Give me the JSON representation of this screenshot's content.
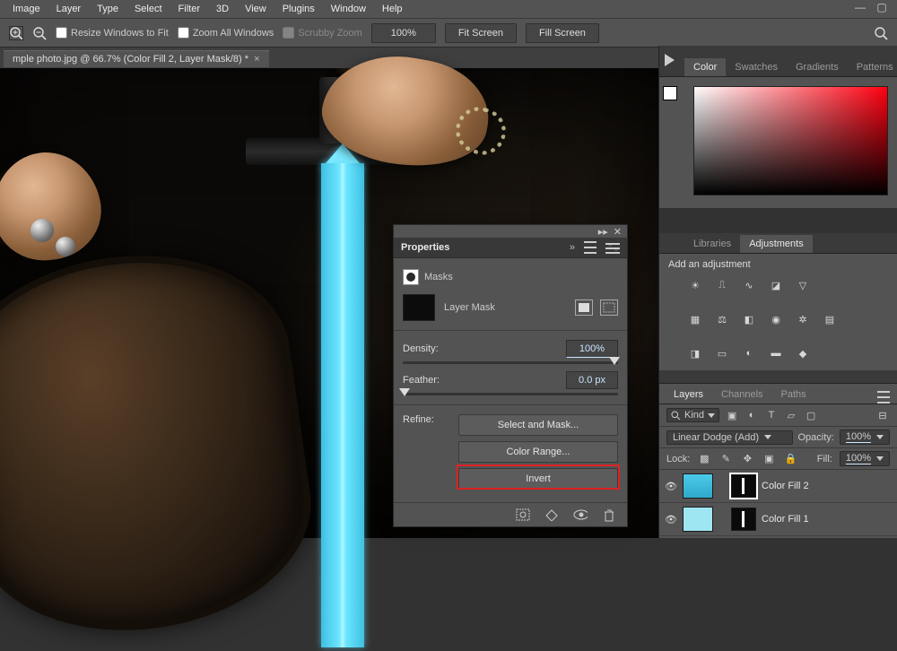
{
  "menubar": [
    "Image",
    "Layer",
    "Type",
    "Select",
    "Filter",
    "3D",
    "View",
    "Plugins",
    "Window",
    "Help"
  ],
  "optionsbar": {
    "resize_windows": "Resize Windows to Fit",
    "zoom_all": "Zoom All Windows",
    "scrubby": "Scrubby Zoom",
    "zoom_value": "100%",
    "fit_screen": "Fit Screen",
    "fill_screen": "Fill Screen"
  },
  "document_tab": {
    "title": "mple photo.jpg @ 66.7% (Color Fill 2, Layer Mask/8) *"
  },
  "properties": {
    "panel_title": "Properties",
    "section": "Masks",
    "mask_label": "Layer Mask",
    "density_label": "Density:",
    "density_value": "100%",
    "feather_label": "Feather:",
    "feather_value": "0.0 px",
    "refine_label": "Refine:",
    "select_and_mask": "Select and Mask...",
    "color_range": "Color Range...",
    "invert": "Invert"
  },
  "right": {
    "color_tabs": [
      "Color",
      "Swatches",
      "Gradients",
      "Patterns"
    ],
    "lib_tabs": [
      "Libraries",
      "Adjustments"
    ],
    "add_adjustment": "Add an adjustment",
    "layers_tabs": [
      "Layers",
      "Channels",
      "Paths"
    ],
    "kind_label": "Kind",
    "blend_mode": "Linear Dodge (Add)",
    "opacity_label": "Opacity:",
    "opacity_value": "100%",
    "lock_label": "Lock:",
    "fill_label": "Fill:",
    "fill_value": "100%",
    "layers": [
      {
        "name": "Color Fill 2"
      },
      {
        "name": "Color Fill 1"
      }
    ]
  }
}
